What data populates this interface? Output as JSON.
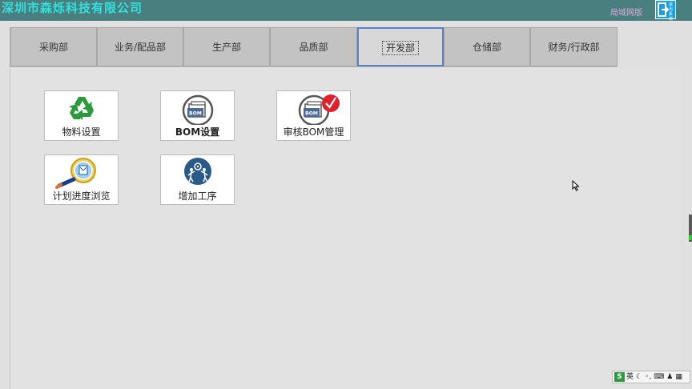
{
  "header": {
    "company_name": "深圳市森烁科技有限公司",
    "network_label": "局域网版",
    "exit_label": "退出系统"
  },
  "colors": {
    "header_bg": "#4a7f7f",
    "company_text": "#33e0e0",
    "active_tab_border": "#5c7fc0",
    "recycle_green": "#2a9a3a",
    "check_red": "#e0202a"
  },
  "tabs": [
    {
      "label": "采购部",
      "active": false
    },
    {
      "label": "业务/配品部",
      "active": false
    },
    {
      "label": "生产部",
      "active": false
    },
    {
      "label": "品质部",
      "active": false
    },
    {
      "label": "开发部",
      "active": true
    },
    {
      "label": "仓储部",
      "active": false
    },
    {
      "label": "财务/行政部",
      "active": false
    }
  ],
  "tiles": [
    {
      "label": "物料设置",
      "icon": "recycle-icon"
    },
    {
      "label": "BOM设置",
      "icon": "bom-folder-icon",
      "badge": "BOM"
    },
    {
      "label": "审核BOM管理",
      "icon": "bom-approve-icon",
      "badge": "BOM"
    },
    {
      "label": "计划进度浏览",
      "icon": "magnifier-icon"
    },
    {
      "label": "增加工序",
      "icon": "workers-gear-icon"
    }
  ],
  "ime": {
    "logo": "S",
    "mode": "英",
    "icons": [
      "moon-icon",
      "punctuation-icon",
      "keyboard-icon",
      "person-icon",
      "grid-icon"
    ]
  }
}
